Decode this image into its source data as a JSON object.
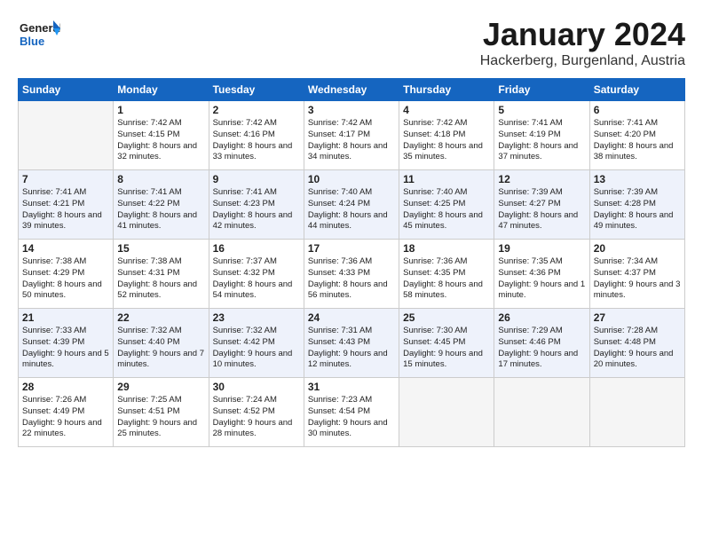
{
  "header": {
    "logo_line1": "General",
    "logo_line2": "Blue",
    "month": "January 2024",
    "location": "Hackerberg, Burgenland, Austria"
  },
  "weekdays": [
    "Sunday",
    "Monday",
    "Tuesday",
    "Wednesday",
    "Thursday",
    "Friday",
    "Saturday"
  ],
  "weeks": [
    [
      {
        "day": "",
        "sunrise": "",
        "sunset": "",
        "daylight": "",
        "empty": true
      },
      {
        "day": "1",
        "sunrise": "Sunrise: 7:42 AM",
        "sunset": "Sunset: 4:15 PM",
        "daylight": "Daylight: 8 hours and 32 minutes."
      },
      {
        "day": "2",
        "sunrise": "Sunrise: 7:42 AM",
        "sunset": "Sunset: 4:16 PM",
        "daylight": "Daylight: 8 hours and 33 minutes."
      },
      {
        "day": "3",
        "sunrise": "Sunrise: 7:42 AM",
        "sunset": "Sunset: 4:17 PM",
        "daylight": "Daylight: 8 hours and 34 minutes."
      },
      {
        "day": "4",
        "sunrise": "Sunrise: 7:42 AM",
        "sunset": "Sunset: 4:18 PM",
        "daylight": "Daylight: 8 hours and 35 minutes."
      },
      {
        "day": "5",
        "sunrise": "Sunrise: 7:41 AM",
        "sunset": "Sunset: 4:19 PM",
        "daylight": "Daylight: 8 hours and 37 minutes."
      },
      {
        "day": "6",
        "sunrise": "Sunrise: 7:41 AM",
        "sunset": "Sunset: 4:20 PM",
        "daylight": "Daylight: 8 hours and 38 minutes."
      }
    ],
    [
      {
        "day": "7",
        "sunrise": "Sunrise: 7:41 AM",
        "sunset": "Sunset: 4:21 PM",
        "daylight": "Daylight: 8 hours and 39 minutes."
      },
      {
        "day": "8",
        "sunrise": "Sunrise: 7:41 AM",
        "sunset": "Sunset: 4:22 PM",
        "daylight": "Daylight: 8 hours and 41 minutes."
      },
      {
        "day": "9",
        "sunrise": "Sunrise: 7:41 AM",
        "sunset": "Sunset: 4:23 PM",
        "daylight": "Daylight: 8 hours and 42 minutes."
      },
      {
        "day": "10",
        "sunrise": "Sunrise: 7:40 AM",
        "sunset": "Sunset: 4:24 PM",
        "daylight": "Daylight: 8 hours and 44 minutes."
      },
      {
        "day": "11",
        "sunrise": "Sunrise: 7:40 AM",
        "sunset": "Sunset: 4:25 PM",
        "daylight": "Daylight: 8 hours and 45 minutes."
      },
      {
        "day": "12",
        "sunrise": "Sunrise: 7:39 AM",
        "sunset": "Sunset: 4:27 PM",
        "daylight": "Daylight: 8 hours and 47 minutes."
      },
      {
        "day": "13",
        "sunrise": "Sunrise: 7:39 AM",
        "sunset": "Sunset: 4:28 PM",
        "daylight": "Daylight: 8 hours and 49 minutes."
      }
    ],
    [
      {
        "day": "14",
        "sunrise": "Sunrise: 7:38 AM",
        "sunset": "Sunset: 4:29 PM",
        "daylight": "Daylight: 8 hours and 50 minutes."
      },
      {
        "day": "15",
        "sunrise": "Sunrise: 7:38 AM",
        "sunset": "Sunset: 4:31 PM",
        "daylight": "Daylight: 8 hours and 52 minutes."
      },
      {
        "day": "16",
        "sunrise": "Sunrise: 7:37 AM",
        "sunset": "Sunset: 4:32 PM",
        "daylight": "Daylight: 8 hours and 54 minutes."
      },
      {
        "day": "17",
        "sunrise": "Sunrise: 7:36 AM",
        "sunset": "Sunset: 4:33 PM",
        "daylight": "Daylight: 8 hours and 56 minutes."
      },
      {
        "day": "18",
        "sunrise": "Sunrise: 7:36 AM",
        "sunset": "Sunset: 4:35 PM",
        "daylight": "Daylight: 8 hours and 58 minutes."
      },
      {
        "day": "19",
        "sunrise": "Sunrise: 7:35 AM",
        "sunset": "Sunset: 4:36 PM",
        "daylight": "Daylight: 9 hours and 1 minute."
      },
      {
        "day": "20",
        "sunrise": "Sunrise: 7:34 AM",
        "sunset": "Sunset: 4:37 PM",
        "daylight": "Daylight: 9 hours and 3 minutes."
      }
    ],
    [
      {
        "day": "21",
        "sunrise": "Sunrise: 7:33 AM",
        "sunset": "Sunset: 4:39 PM",
        "daylight": "Daylight: 9 hours and 5 minutes."
      },
      {
        "day": "22",
        "sunrise": "Sunrise: 7:32 AM",
        "sunset": "Sunset: 4:40 PM",
        "daylight": "Daylight: 9 hours and 7 minutes."
      },
      {
        "day": "23",
        "sunrise": "Sunrise: 7:32 AM",
        "sunset": "Sunset: 4:42 PM",
        "daylight": "Daylight: 9 hours and 10 minutes."
      },
      {
        "day": "24",
        "sunrise": "Sunrise: 7:31 AM",
        "sunset": "Sunset: 4:43 PM",
        "daylight": "Daylight: 9 hours and 12 minutes."
      },
      {
        "day": "25",
        "sunrise": "Sunrise: 7:30 AM",
        "sunset": "Sunset: 4:45 PM",
        "daylight": "Daylight: 9 hours and 15 minutes."
      },
      {
        "day": "26",
        "sunrise": "Sunrise: 7:29 AM",
        "sunset": "Sunset: 4:46 PM",
        "daylight": "Daylight: 9 hours and 17 minutes."
      },
      {
        "day": "27",
        "sunrise": "Sunrise: 7:28 AM",
        "sunset": "Sunset: 4:48 PM",
        "daylight": "Daylight: 9 hours and 20 minutes."
      }
    ],
    [
      {
        "day": "28",
        "sunrise": "Sunrise: 7:26 AM",
        "sunset": "Sunset: 4:49 PM",
        "daylight": "Daylight: 9 hours and 22 minutes."
      },
      {
        "day": "29",
        "sunrise": "Sunrise: 7:25 AM",
        "sunset": "Sunset: 4:51 PM",
        "daylight": "Daylight: 9 hours and 25 minutes."
      },
      {
        "day": "30",
        "sunrise": "Sunrise: 7:24 AM",
        "sunset": "Sunset: 4:52 PM",
        "daylight": "Daylight: 9 hours and 28 minutes."
      },
      {
        "day": "31",
        "sunrise": "Sunrise: 7:23 AM",
        "sunset": "Sunset: 4:54 PM",
        "daylight": "Daylight: 9 hours and 30 minutes."
      },
      {
        "day": "",
        "sunrise": "",
        "sunset": "",
        "daylight": "",
        "empty": true
      },
      {
        "day": "",
        "sunrise": "",
        "sunset": "",
        "daylight": "",
        "empty": true
      },
      {
        "day": "",
        "sunrise": "",
        "sunset": "",
        "daylight": "",
        "empty": true
      }
    ]
  ]
}
